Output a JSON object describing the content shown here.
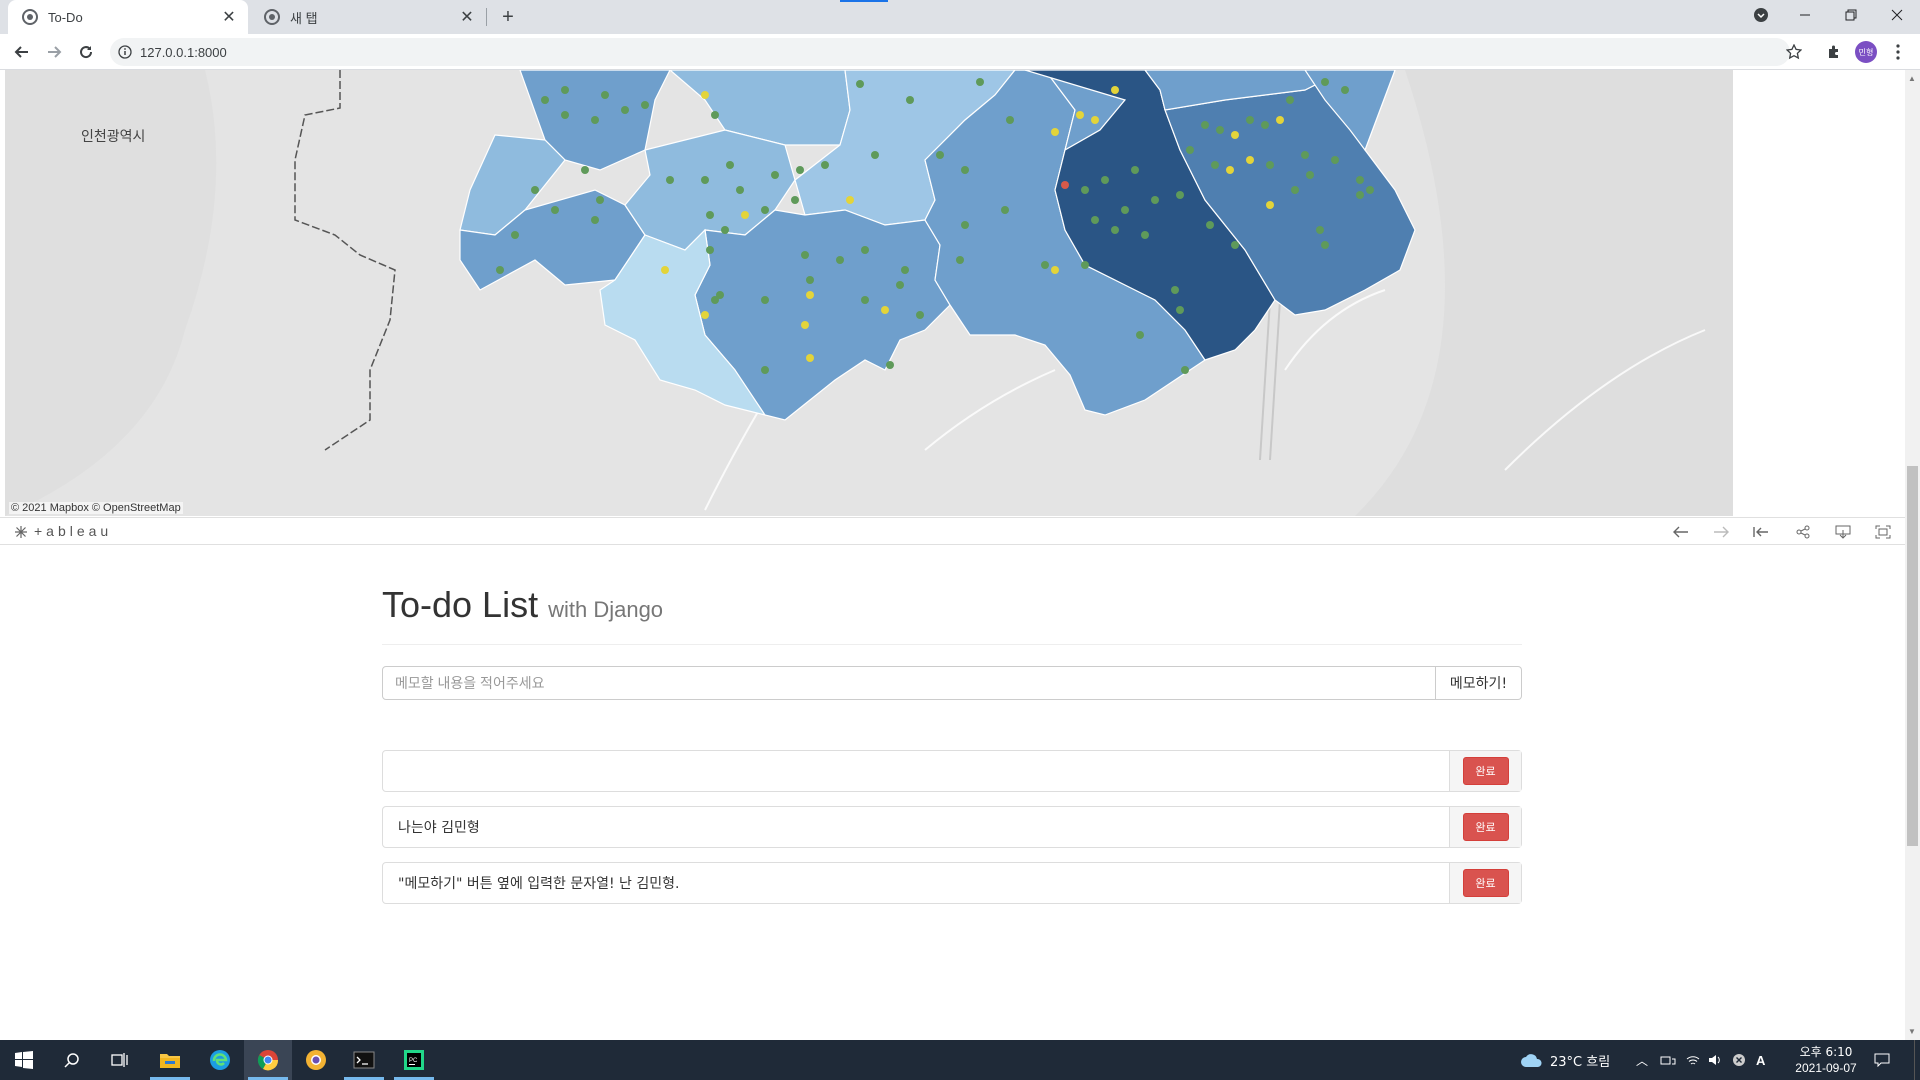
{
  "browser": {
    "tabs": [
      {
        "title": "To-Do",
        "active": true
      },
      {
        "title": "새 탭",
        "active": false
      }
    ],
    "url": "127.0.0.1:8000",
    "profile_initials": "민형"
  },
  "map": {
    "place_label": "인천광역시",
    "attribution": "© 2021 Mapbox  © OpenStreetMap",
    "colors": {
      "lightest": "#b9dcf0",
      "light": "#8fbbde",
      "mid": "#6f9fcc",
      "dark": "#4f7fb0",
      "darkest": "#2a5585",
      "dot_green": "#5f9a5a",
      "dot_yellow": "#e3d43a",
      "dot_red": "#d85a4a"
    }
  },
  "tableau": {
    "logo": "+ableau"
  },
  "todo": {
    "title": "To-do List",
    "subtitle": "with Django",
    "input_placeholder": "메모할 내용을 적어주세요",
    "submit_label": "메모하기!",
    "items": [
      {
        "text": "",
        "button": "완료"
      },
      {
        "text": "나는야 김민형",
        "button": "완료"
      },
      {
        "text": "\"메모하기\" 버튼 옆에 입력한 문자열! 난 김민형.",
        "button": "완료"
      }
    ]
  },
  "taskbar": {
    "weather": "23°C  흐림",
    "time": "오후 6:10",
    "date": "2021-09-07",
    "ime": "A"
  }
}
